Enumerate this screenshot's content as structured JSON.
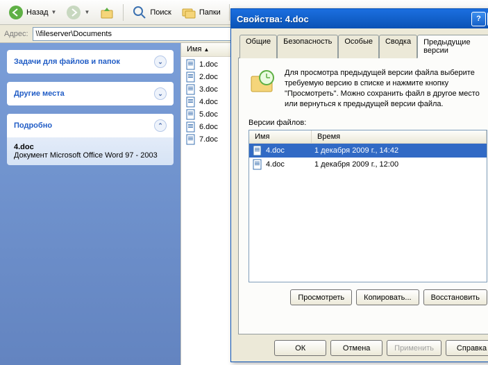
{
  "toolbar": {
    "back": "Назад",
    "search": "Поиск",
    "folders": "Папки"
  },
  "address": {
    "label": "Адрес:",
    "value": "\\\\fileserver\\Documents"
  },
  "sidebar": {
    "panels": [
      {
        "title": "Задачи для файлов и папок"
      },
      {
        "title": "Другие места"
      },
      {
        "title": "Подробно",
        "file": "4.doc",
        "desc": "Документ Microsoft Office Word 97 - 2003"
      }
    ]
  },
  "filepane": {
    "col_name": "Имя",
    "files": [
      "1.doc",
      "2.doc",
      "3.doc",
      "4.doc",
      "5.doc",
      "6.doc",
      "7.doc"
    ]
  },
  "dialog": {
    "title": "Свойства: 4.doc",
    "tabs": [
      "Общие",
      "Безопасность",
      "Особые",
      "Сводка",
      "Предыдущие версии"
    ],
    "active_tab": 4,
    "help_text": "Для просмотра предыдущей версии файла выберите требуемую версию в списке и нажмите кнопку \"Просмотреть\". Можно сохранить файл в другое место или вернуться к предыдущей версии файла.",
    "versions_label": "Версии файлов:",
    "ver_cols": {
      "name": "Имя",
      "time": "Время"
    },
    "versions": [
      {
        "name": "4.doc",
        "time": "1 декабря 2009 г., 14:42",
        "selected": true
      },
      {
        "name": "4.doc",
        "time": "1 декабря 2009 г., 12:00",
        "selected": false
      }
    ],
    "actions": {
      "view": "Просмотреть",
      "copy": "Копировать...",
      "restore": "Восстановить"
    },
    "buttons": {
      "ok": "ОК",
      "cancel": "Отмена",
      "apply": "Применить",
      "help": "Справка"
    }
  }
}
